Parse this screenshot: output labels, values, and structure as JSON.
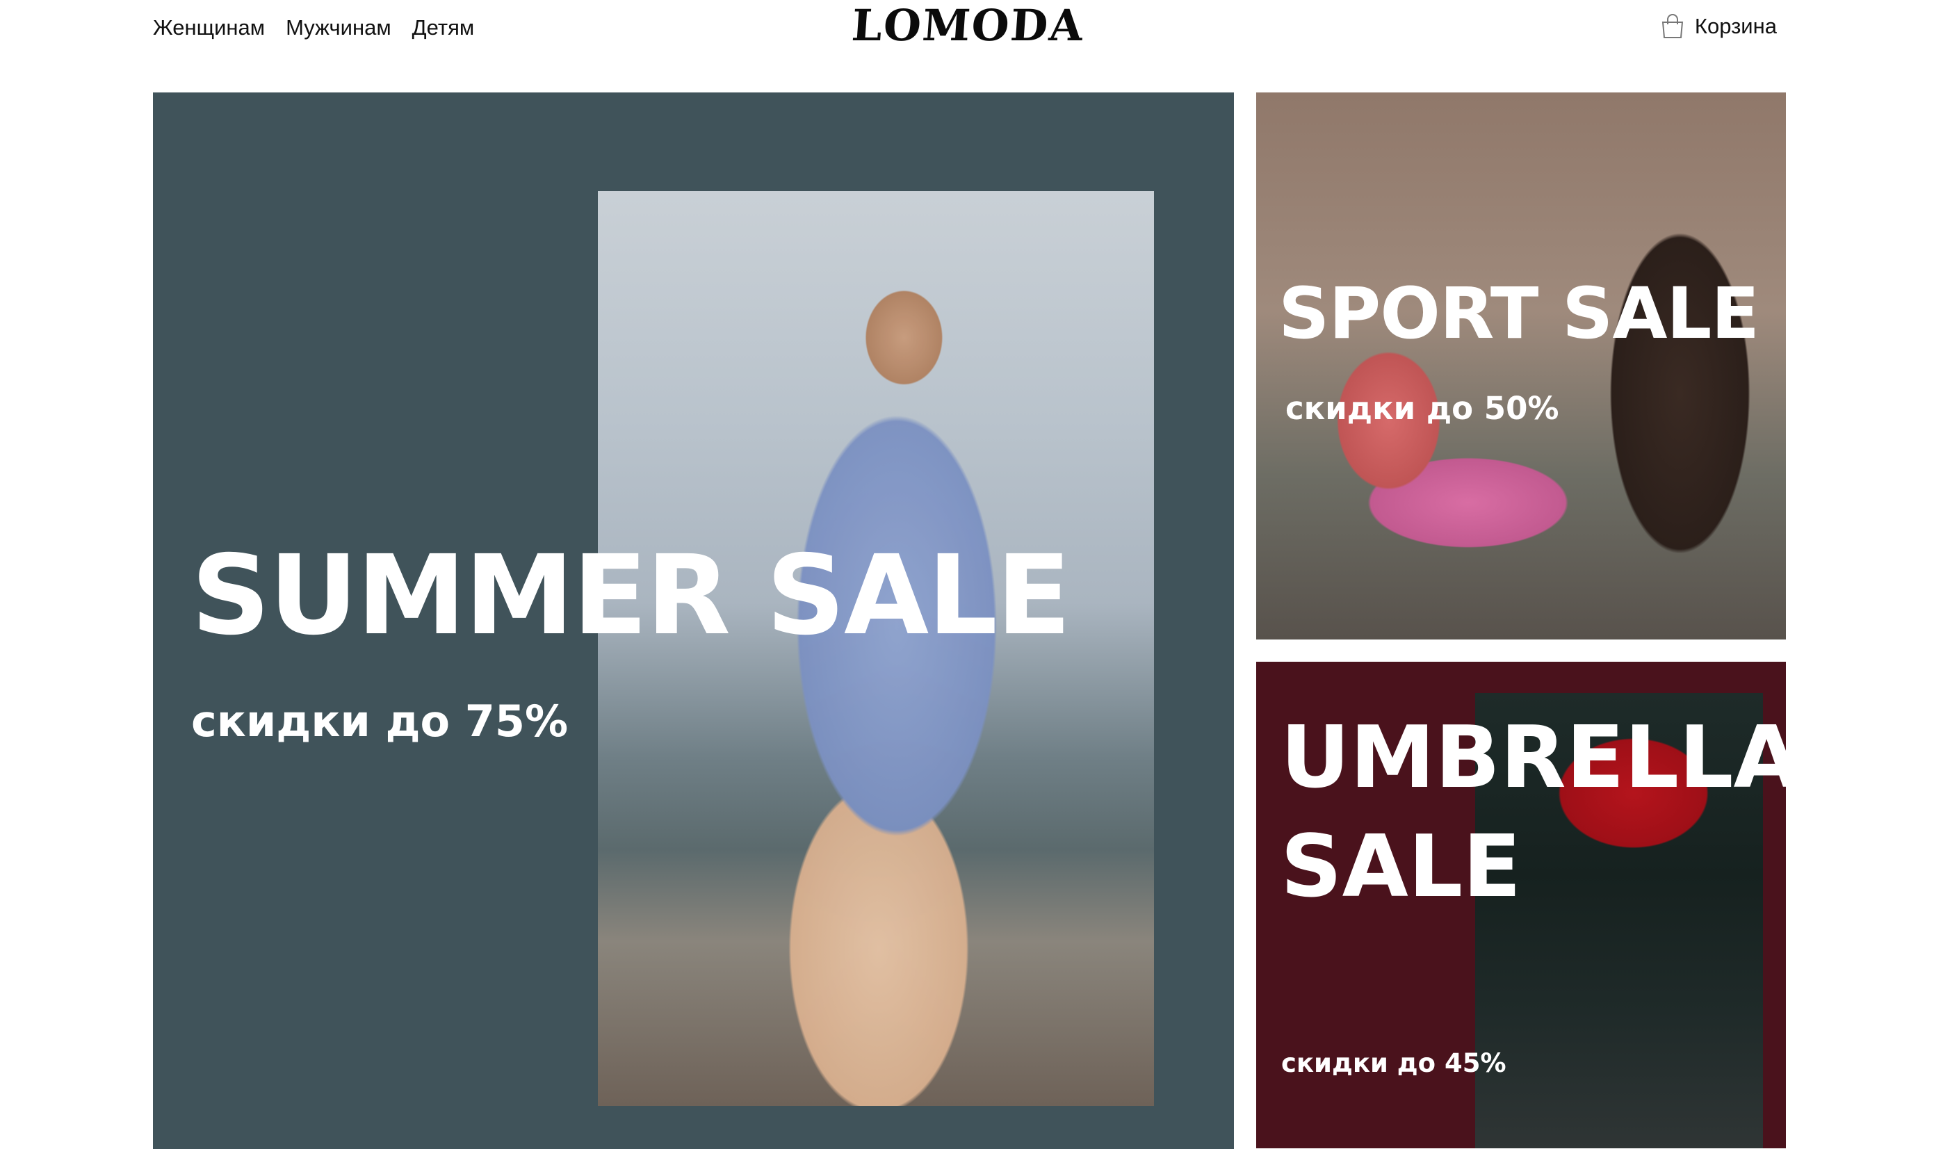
{
  "header": {
    "nav": [
      {
        "label": "Женщинам"
      },
      {
        "label": "Мужчинам"
      },
      {
        "label": "Детям"
      }
    ],
    "logo": "LOMODA",
    "cart_label": "Корзина",
    "cart_icon": "shopping-bag-icon"
  },
  "banners": {
    "summer": {
      "title": "SUMMER SALE",
      "subtitle": "скидки до 75%",
      "background": "#40535a"
    },
    "sport": {
      "title": "SPORT SALE",
      "subtitle": "скидки до 50%"
    },
    "umbrella": {
      "title": "UMBRELLA\nSALE",
      "subtitle": "скидки до 45%",
      "background": "#4a121c"
    }
  }
}
